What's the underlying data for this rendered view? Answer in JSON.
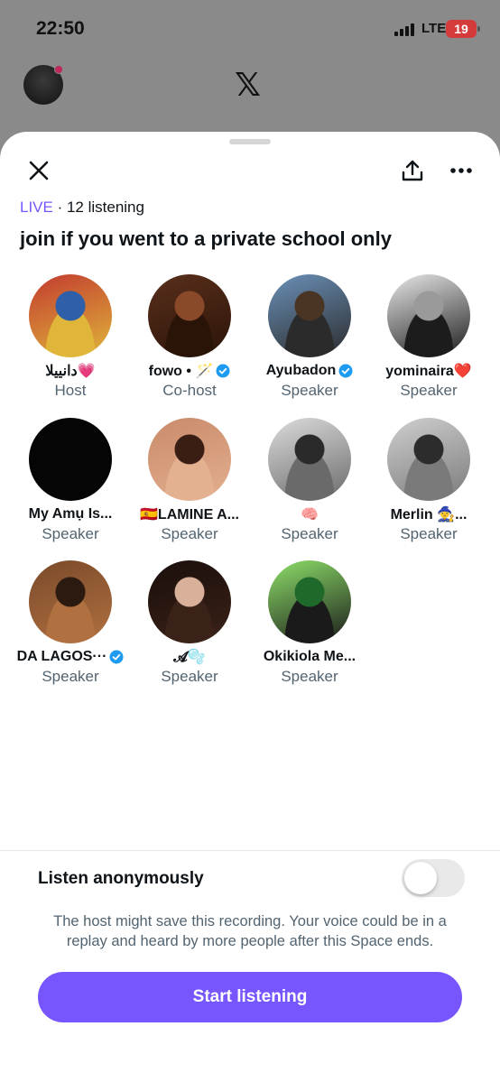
{
  "status": {
    "time": "22:50",
    "network": "LTE",
    "battery": "19"
  },
  "header": {
    "logo": "𝕏"
  },
  "space": {
    "live_label": "LIVE",
    "listening": " · 12 listening",
    "title": "join if you went to a private school only"
  },
  "participants": [
    {
      "name": "دانييلا💗",
      "role": "Host",
      "verified": false,
      "avatar_colors": [
        "#c23b2f",
        "#2e5fa8",
        "#e0b63a"
      ]
    },
    {
      "name": "fowo • 🪄",
      "role": "Co-host",
      "verified": true,
      "avatar_colors": [
        "#5a2f1c",
        "#8a4a2a",
        "#2a1408"
      ]
    },
    {
      "name": "Ayubadon",
      "role": "Speaker",
      "verified": true,
      "avatar_colors": [
        "#6a90b8",
        "#4a3424",
        "#2b2b2b"
      ]
    },
    {
      "name": "yominaira❤️",
      "role": "Speaker",
      "verified": false,
      "avatar_colors": [
        "#e8e8e8",
        "#9a9a9a",
        "#1c1c1c"
      ]
    },
    {
      "name": "My Amụ Is...",
      "role": "Speaker",
      "verified": false,
      "avatar_colors": [
        "#050505",
        "#050505",
        "#050505"
      ]
    },
    {
      "name": "🇪🇸LAMINE A...",
      "role": "Speaker",
      "verified": false,
      "avatar_colors": [
        "#c98a6a",
        "#3a1e14",
        "#e3b090"
      ]
    },
    {
      "name": "🧠",
      "role": "Speaker",
      "verified": false,
      "avatar_colors": [
        "#dcdcdc",
        "#2a2a2a",
        "#6a6a6a"
      ]
    },
    {
      "name": "Merlin 🧙...",
      "role": "Speaker",
      "verified": false,
      "avatar_colors": [
        "#cfcfcf",
        "#2c2c2c",
        "#7a7a7a"
      ]
    },
    {
      "name": "DA LAGOS···",
      "role": "Speaker",
      "verified": true,
      "avatar_colors": [
        "#7a4a2a",
        "#2a1a10",
        "#b07040"
      ]
    },
    {
      "name": "𝓐🫧",
      "role": "Speaker",
      "verified": false,
      "avatar_colors": [
        "#1a0e0a",
        "#d9b09a",
        "#3a2218"
      ]
    },
    {
      "name": "Okikiola Me...",
      "role": "Speaker",
      "verified": false,
      "avatar_colors": [
        "#8ee06a",
        "#1f6a2a",
        "#1a1a1a"
      ]
    }
  ],
  "anonymous": {
    "label": "Listen anonymously",
    "enabled": false
  },
  "notice": "The host might save this recording. Your voice could be in a replay and heard by more people after this Space ends.",
  "start_button": "Start listening",
  "colors": {
    "accent": "#7856ff",
    "verified": "#1d9bf0",
    "secondary_text": "#536471"
  }
}
